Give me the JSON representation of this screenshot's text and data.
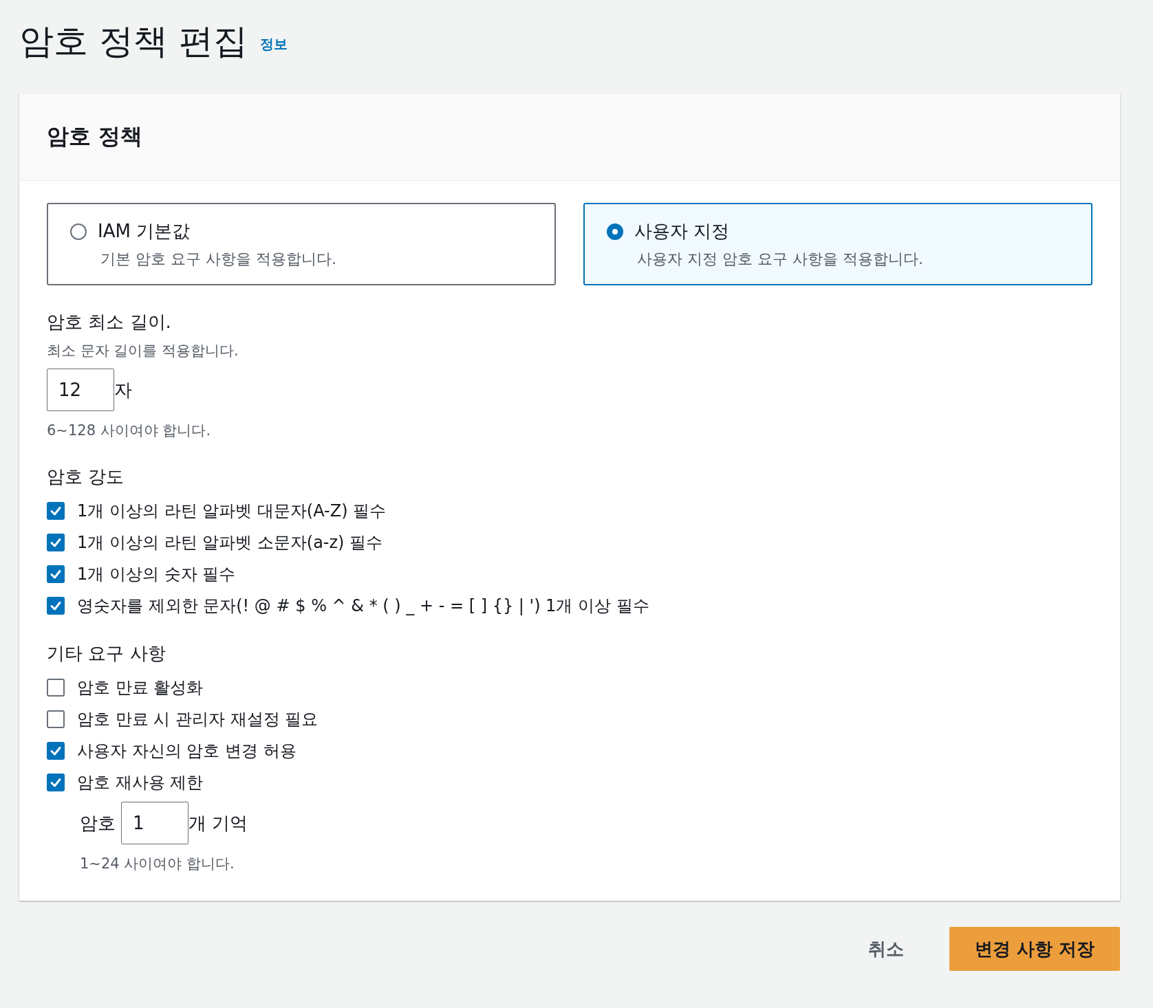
{
  "page": {
    "title": "암호 정책 편집",
    "info_link": "정보"
  },
  "panel": {
    "title": "암호 정책",
    "policy_options": [
      {
        "label": "IAM 기본값",
        "description": "기본 암호 요구 사항을 적용합니다.",
        "selected": false
      },
      {
        "label": "사용자 지정",
        "description": "사용자 지정 암호 요구 사항을 적용합니다.",
        "selected": true
      }
    ],
    "min_length": {
      "label": "암호 최소 길이.",
      "description": "최소 문자 길이를 적용합니다.",
      "value": "12",
      "unit": "자",
      "hint": "6~128 사이여야 합니다."
    },
    "strength": {
      "heading": "암호 강도",
      "options": [
        {
          "label": "1개 이상의 라틴 알파벳 대문자(A-Z) 필수",
          "checked": true
        },
        {
          "label": "1개 이상의 라틴 알파벳 소문자(a-z) 필수",
          "checked": true
        },
        {
          "label": "1개 이상의 숫자 필수",
          "checked": true
        },
        {
          "label": "영숫자를 제외한 문자(! @ # $ % ^ & * ( ) _ + - = [ ] {} | ') 1개 이상 필수",
          "checked": true
        }
      ]
    },
    "other": {
      "heading": "기타 요구 사항",
      "options": [
        {
          "label": "암호 만료 활성화",
          "checked": false
        },
        {
          "label": "암호 만료 시 관리자 재설정 필요",
          "checked": false
        },
        {
          "label": "사용자 자신의 암호 변경 허용",
          "checked": true
        },
        {
          "label": "암호 재사용 제한",
          "checked": true
        }
      ],
      "reuse": {
        "prefix": "암호",
        "value": "1",
        "suffix": "개 기억",
        "hint": "1~24 사이여야 합니다."
      }
    }
  },
  "actions": {
    "cancel": "취소",
    "save": "변경 사항 저장"
  }
}
